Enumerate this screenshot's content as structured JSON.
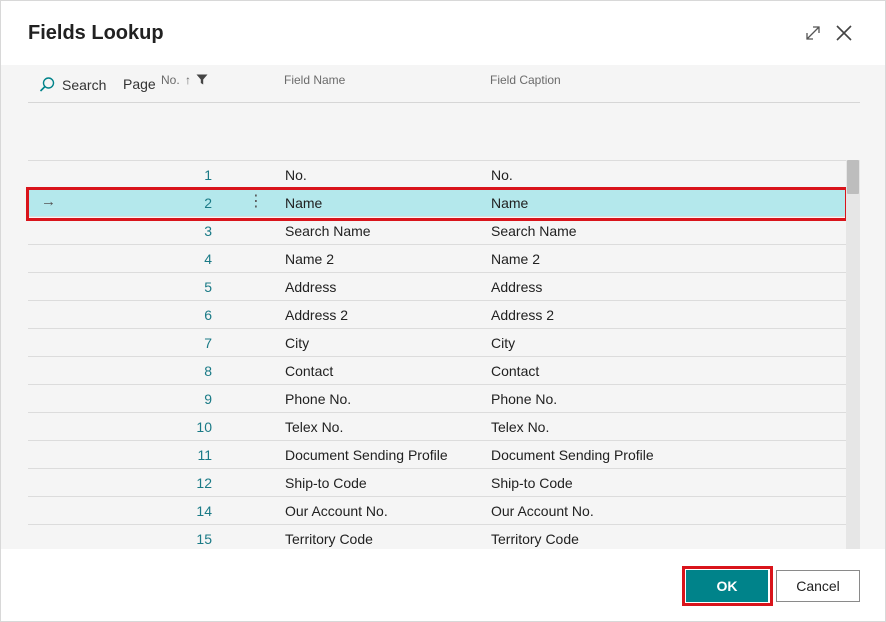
{
  "dialog": {
    "title": "Fields Lookup",
    "expand_icon": "expand-icon",
    "close_icon": "close-icon"
  },
  "actions": {
    "search_label": "Search",
    "page_label": "Page"
  },
  "columns": {
    "no": "No.",
    "field_name": "Field Name",
    "field_caption": "Field Caption"
  },
  "rows": [
    {
      "no": "1",
      "name": "No.",
      "caption": "No."
    },
    {
      "no": "2",
      "name": "Name",
      "caption": "Name"
    },
    {
      "no": "3",
      "name": "Search Name",
      "caption": "Search Name"
    },
    {
      "no": "4",
      "name": "Name 2",
      "caption": "Name 2"
    },
    {
      "no": "5",
      "name": "Address",
      "caption": "Address"
    },
    {
      "no": "6",
      "name": "Address 2",
      "caption": "Address 2"
    },
    {
      "no": "7",
      "name": "City",
      "caption": "City"
    },
    {
      "no": "8",
      "name": "Contact",
      "caption": "Contact"
    },
    {
      "no": "9",
      "name": "Phone No.",
      "caption": "Phone No."
    },
    {
      "no": "10",
      "name": "Telex No.",
      "caption": "Telex No."
    },
    {
      "no": "11",
      "name": "Document Sending Profile",
      "caption": "Document Sending Profile"
    },
    {
      "no": "12",
      "name": "Ship-to Code",
      "caption": "Ship-to Code"
    },
    {
      "no": "14",
      "name": "Our Account No.",
      "caption": "Our Account No."
    },
    {
      "no": "15",
      "name": "Territory Code",
      "caption": "Territory Code"
    }
  ],
  "selected_row": "2",
  "footer": {
    "ok_label": "OK",
    "cancel_label": "Cancel"
  },
  "colors": {
    "accent": "#00838a",
    "selection": "#b4e8ec",
    "highlight_outline": "#d9141b",
    "number_text": "#1a7a86"
  }
}
